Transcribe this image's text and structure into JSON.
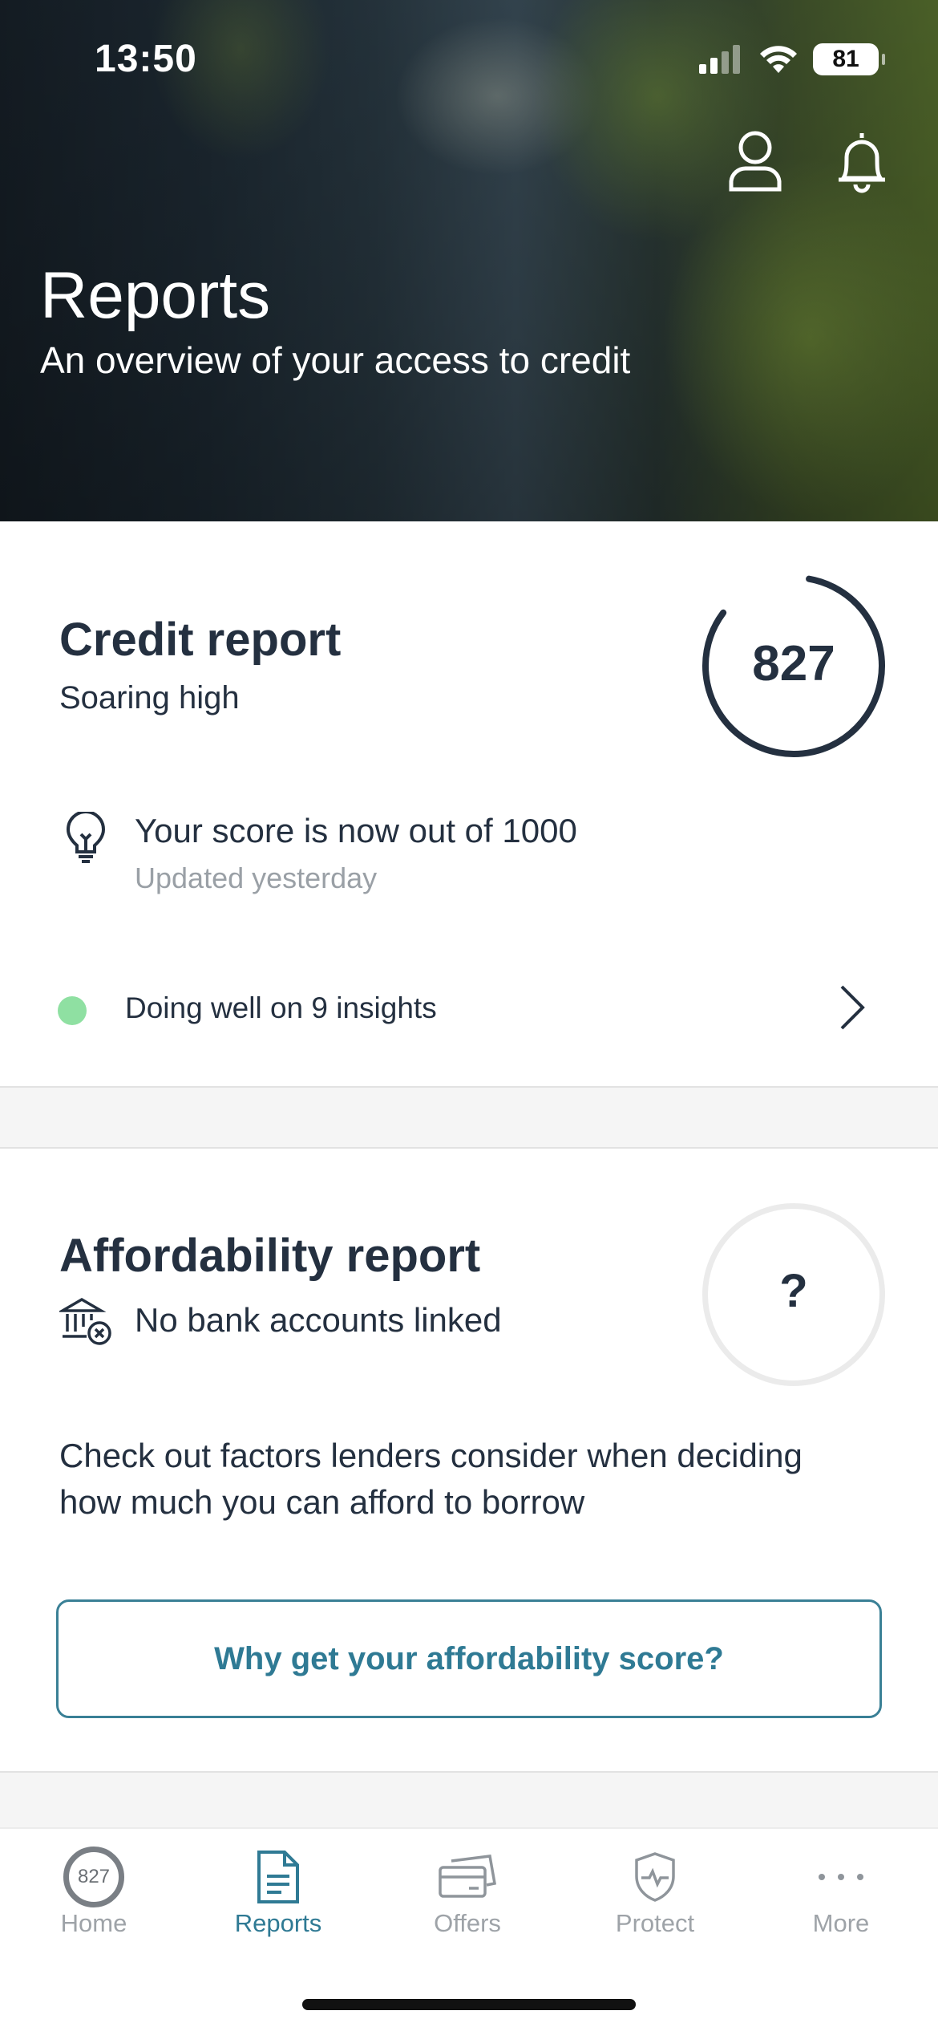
{
  "status_bar": {
    "time": "13:50",
    "battery": "81"
  },
  "header": {
    "title": "Reports",
    "subtitle": "An overview of your access to credit"
  },
  "credit_report": {
    "title": "Credit report",
    "status": "Soaring high",
    "score": "827",
    "tip": "Your score is now out of 1000",
    "tip_meta": "Updated yesterday",
    "insights_label": "Doing well on 9 insights",
    "insight_dot_color": "#8fe0a2"
  },
  "affordability_report": {
    "title": "Affordability report",
    "bank_status": "No bank accounts linked",
    "score": "?",
    "description": "Check out factors lenders consider when deciding how much you can afford to borrow",
    "cta_label": "Why get your affordability score?"
  },
  "tabbar": {
    "tabs": [
      {
        "label": "Home",
        "icon": "score-ring-icon",
        "badge": "827"
      },
      {
        "label": "Reports",
        "icon": "document-icon",
        "active": true
      },
      {
        "label": "Offers",
        "icon": "cards-icon"
      },
      {
        "label": "Protect",
        "icon": "shield-icon"
      },
      {
        "label": "More",
        "icon": "more-dots-icon"
      }
    ]
  },
  "colors": {
    "accent": "#2f7a94",
    "text": "#243040",
    "muted": "#9aa0a6",
    "insight_good": "#8fe0a2"
  }
}
